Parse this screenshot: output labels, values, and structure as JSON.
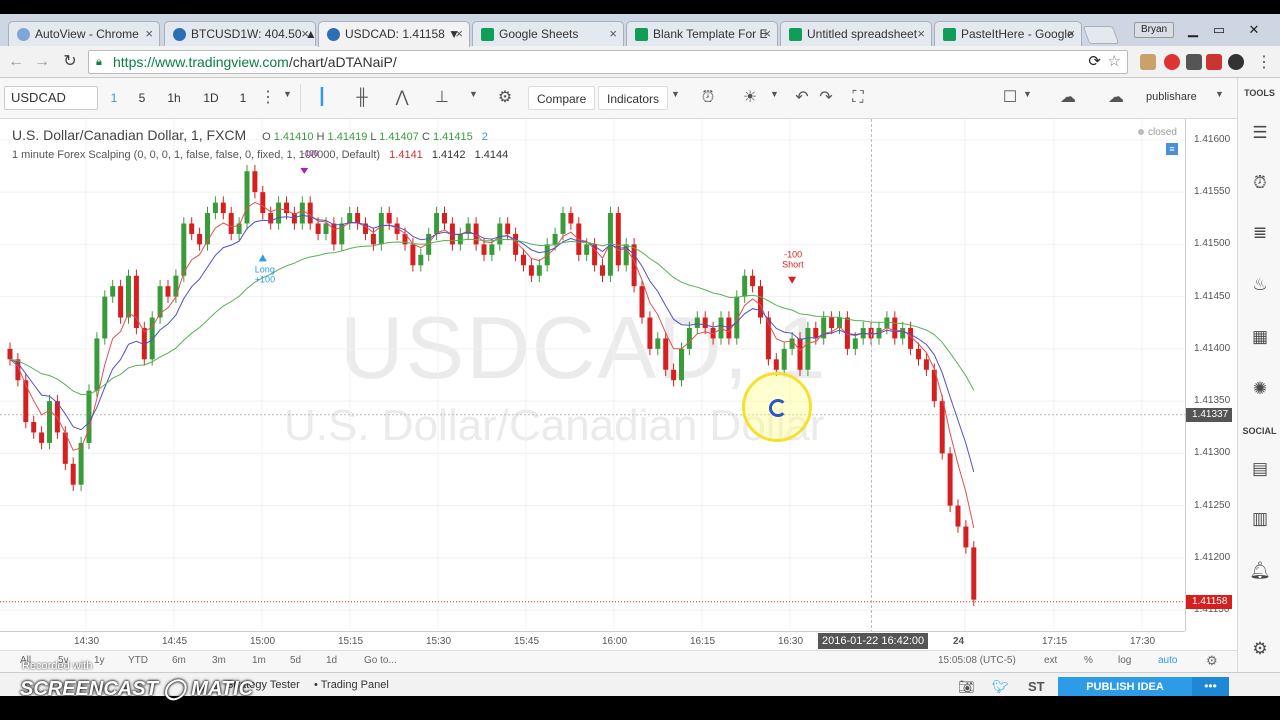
{
  "browser": {
    "tabs": [
      {
        "title": "AutoView - Chrome",
        "icon": "autoview-icon",
        "active": false
      },
      {
        "title": "BTCUSD1W: 404.50 ▲",
        "icon": "tradingview-icon",
        "active": false
      },
      {
        "title": "USDCAD: 1.41158 ▼",
        "icon": "tradingview-icon",
        "active": true
      },
      {
        "title": "Google Sheets",
        "icon": "sheets-icon",
        "active": false
      },
      {
        "title": "Blank Template For E",
        "icon": "sheets-icon",
        "active": false
      },
      {
        "title": "Untitled spreadsheet",
        "icon": "sheets-icon",
        "active": false
      },
      {
        "title": "PasteItHere - Google",
        "icon": "sheets-icon",
        "active": false
      }
    ],
    "profile": "Bryan",
    "url_host": "https://www.tradingview.com",
    "url_path": "/chart/aDTANaiP/"
  },
  "header": {
    "symbol": "USDCAD",
    "intervals": [
      "1",
      "5",
      "1h",
      "1D",
      "1"
    ],
    "compare_label": "Compare",
    "indicators_label": "Indicators",
    "publish_label": "publishare"
  },
  "legend": {
    "title": "U.S. Dollar/Canadian Dollar, 1, FXCM",
    "ohlc": {
      "o": "1.41410",
      "h": "1.41419",
      "l": "1.41407",
      "c": "1.41415"
    },
    "alerts_count": "2",
    "study": "1 minute Forex Scalping (0, 0, 0, 1, false, false, 0, fixed, 1, 100000, Default)",
    "study_values": [
      "1.4141",
      "1.4142",
      "1.4144"
    ],
    "closed_label": "closed"
  },
  "watermark": {
    "symbol": "USDCAD, 1",
    "name": "U.S. Dollar/Canadian Dollar"
  },
  "price_axis": {
    "labels": [
      "1.41600",
      "1.41550",
      "1.41500",
      "1.41450",
      "1.41400",
      "1.41350",
      "1.41300",
      "1.41250",
      "1.41200",
      "1.41150"
    ],
    "crosshair_price": "1.41337",
    "last_price": "1.41158"
  },
  "time_axis": {
    "labels": [
      "14:30",
      "14:45",
      "15:00",
      "15:15",
      "15:30",
      "15:45",
      "16:00",
      "16:15",
      "16:30",
      "24",
      "17:15",
      "17:30"
    ],
    "hover_time": "2016-01-22 16:42:00"
  },
  "signals": {
    "long_label": "Long",
    "long_qty": "+100",
    "short_label": "Short",
    "short_qty": "-100",
    "exit_label": "-100"
  },
  "range_bar": {
    "items": [
      "All",
      "5y",
      "1y",
      "YTD",
      "6m",
      "3m",
      "1m",
      "5d",
      "1d",
      "Go to..."
    ],
    "clock": "15:05:08 (UTC-5)",
    "ext": "ext",
    "pct": "%",
    "log": "log",
    "auto": "auto"
  },
  "bottom_panel": {
    "strategy_tester": "Strategy Tester",
    "trading_panel": "Trading Panel",
    "st_label": "ST",
    "publish_idea": "PUBLISH IDEA"
  },
  "right_bar": {
    "tools_label": "TOOLS",
    "social_label": "SOCIAL"
  },
  "overlay": {
    "recorded_with": "Recorded with",
    "brand": "SCREENCAST ◯ MATIC"
  },
  "colors": {
    "up": "#3a9b3a",
    "down": "#d62020",
    "ma_fast": "#e05050",
    "ma_mid": "#5050c8",
    "ma_slow": "#58b058",
    "accent": "#2d9be5"
  },
  "chart_data": {
    "type": "candlestick",
    "symbol": "USDCAD",
    "interval": "1",
    "ylim": [
      1.4113,
      1.4162
    ],
    "last_close": 1.41158,
    "closes": [
      1.4139,
      1.4137,
      1.4133,
      1.4132,
      1.4131,
      1.4135,
      1.4132,
      1.4129,
      1.4127,
      1.4131,
      1.4136,
      1.4141,
      1.4145,
      1.4146,
      1.4143,
      1.4147,
      1.4142,
      1.4139,
      1.4143,
      1.4146,
      1.4145,
      1.4147,
      1.4152,
      1.4151,
      1.415,
      1.4153,
      1.4154,
      1.4153,
      1.4151,
      1.4152,
      1.4157,
      1.4155,
      1.4153,
      1.4152,
      1.4154,
      1.4153,
      1.4152,
      1.4154,
      1.4152,
      1.4151,
      1.4152,
      1.415,
      1.4152,
      1.4153,
      1.4152,
      1.4151,
      1.415,
      1.4153,
      1.4152,
      1.4151,
      1.415,
      1.4148,
      1.4149,
      1.4151,
      1.4153,
      1.4152,
      1.415,
      1.4151,
      1.4152,
      1.415,
      1.4149,
      1.415,
      1.4152,
      1.4151,
      1.4149,
      1.4148,
      1.4147,
      1.4148,
      1.415,
      1.4151,
      1.4153,
      1.4152,
      1.4149,
      1.415,
      1.4148,
      1.4147,
      1.4153,
      1.4148,
      1.415,
      1.4146,
      1.4143,
      1.414,
      1.4141,
      1.4138,
      1.4137,
      1.414,
      1.4142,
      1.4143,
      1.4142,
      1.4141,
      1.4143,
      1.4141,
      1.4145,
      1.4147,
      1.4146,
      1.4143,
      1.4139,
      1.4138,
      1.414,
      1.4141,
      1.4138,
      1.4142,
      1.4141,
      1.4143,
      1.4142,
      1.4143,
      1.414,
      1.4141,
      1.4142,
      1.4141,
      1.4142,
      1.4143,
      1.4141,
      1.4142,
      1.414,
      1.4139,
      1.4138,
      1.4135,
      1.413,
      1.4125,
      1.4123,
      1.4121,
      1.4116
    ]
  }
}
